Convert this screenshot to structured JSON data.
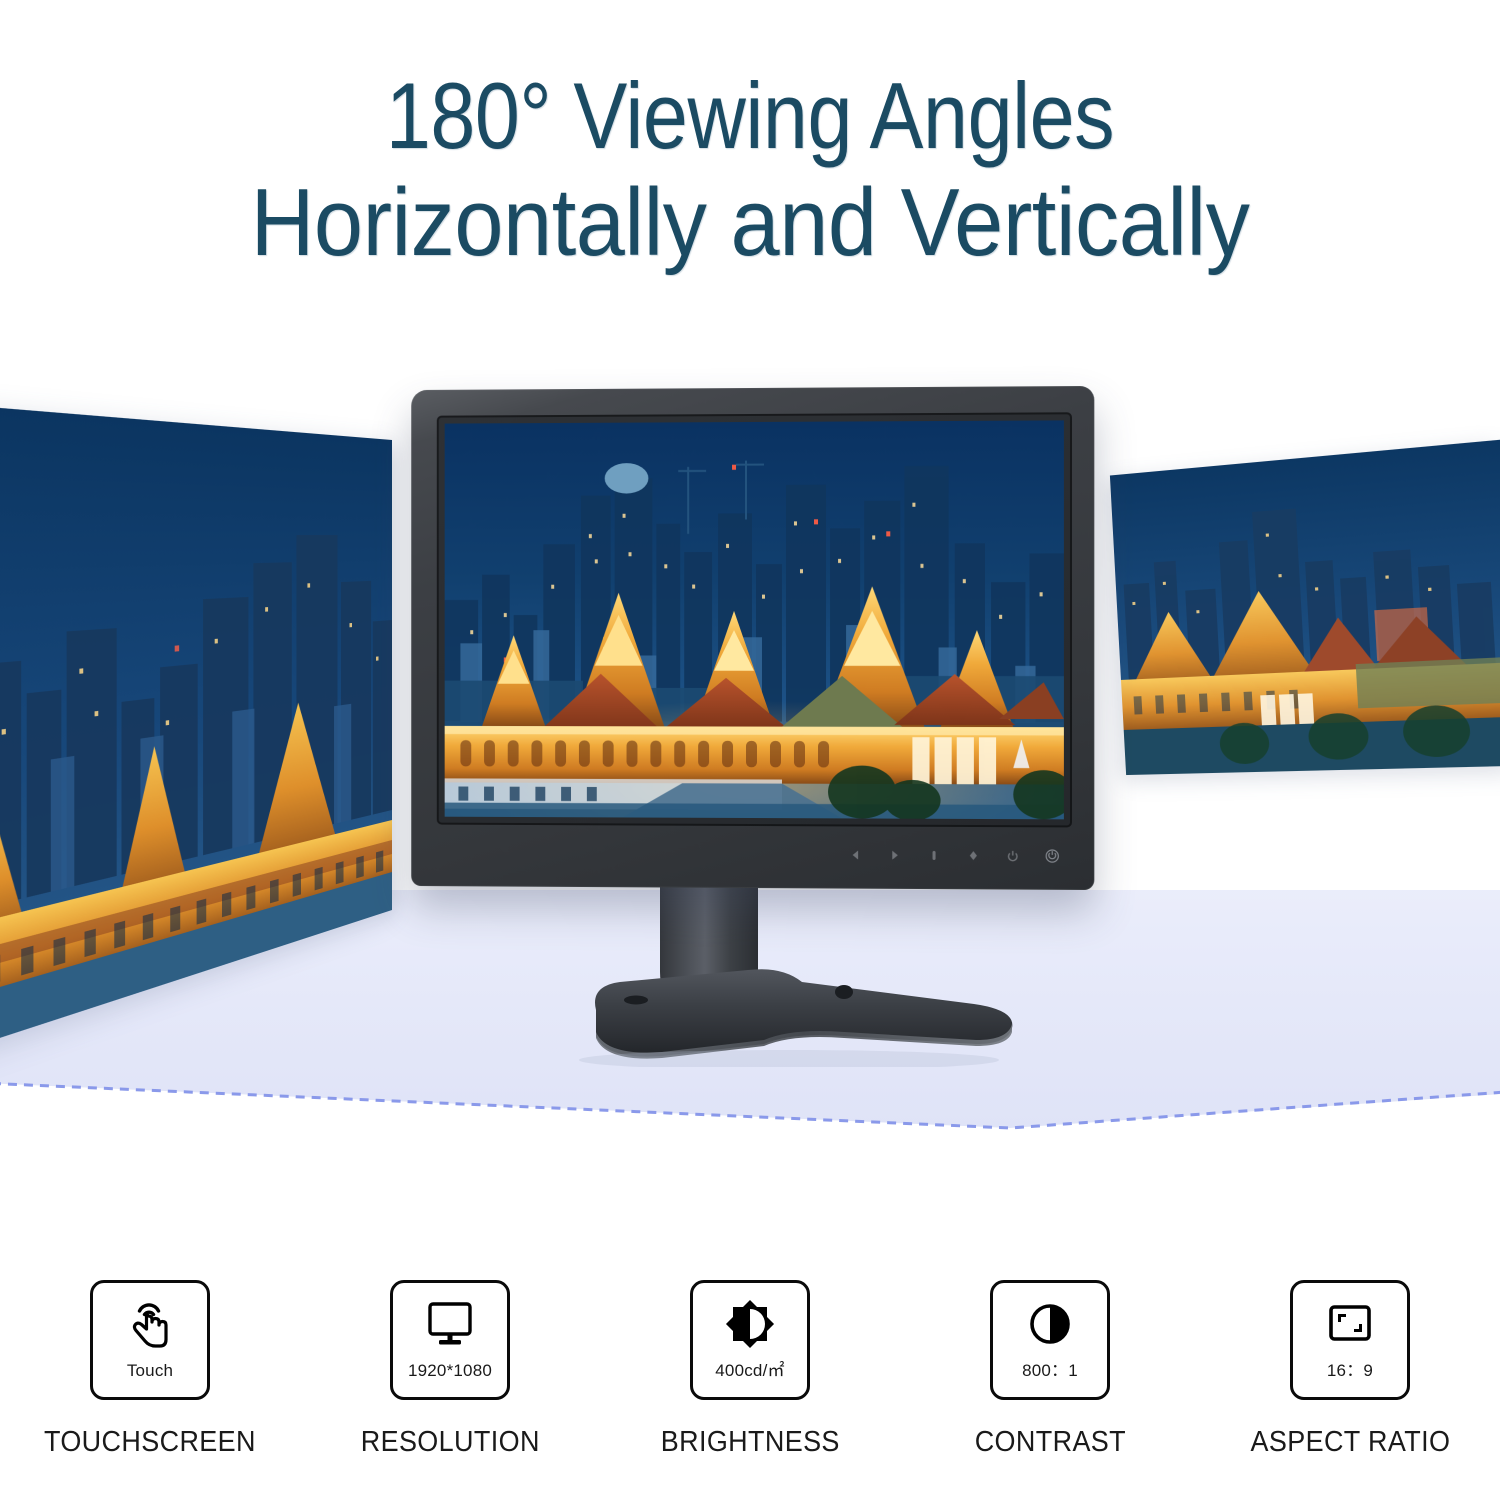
{
  "headline": {
    "line1": "180° Viewing Angles",
    "line2": "Horizontally and Vertically"
  },
  "colors": {
    "headline": "#1b4b63",
    "floor_dash": "#8a99ea",
    "floor_fill": "#eceefb",
    "bezel": "#34373b",
    "screen_sky": "#0d3763",
    "screen_gold": "#e8a13a"
  },
  "product": {
    "type": "touchscreen-monitor",
    "screen_content": "Bangkok Grand Palace illuminated at night with city skyline at dusk",
    "controls": [
      {
        "name": "left-arrow-button",
        "glyph": "left"
      },
      {
        "name": "right-arrow-button",
        "glyph": "right"
      },
      {
        "name": "menu-button",
        "glyph": "menu"
      },
      {
        "name": "source-button",
        "glyph": "diamond"
      },
      {
        "name": "power-button",
        "glyph": "power"
      },
      {
        "name": "power-indicator",
        "glyph": "indicator"
      }
    ]
  },
  "angle_panels": [
    {
      "name": "left-viewing-angle-panel",
      "position": "left"
    },
    {
      "name": "right-viewing-angle-panel",
      "position": "right"
    }
  ],
  "features": [
    {
      "icon": "touch-hand-icon",
      "value": "Touch",
      "label": "TOUCHSCREEN"
    },
    {
      "icon": "monitor-icon",
      "value": "1920*1080",
      "label": "RESOLUTION"
    },
    {
      "icon": "brightness-icon",
      "value": "400cd/㎡",
      "label": "BRIGHTNESS"
    },
    {
      "icon": "contrast-icon",
      "value": "800：1",
      "label": "CONTRAST"
    },
    {
      "icon": "aspect-ratio-icon",
      "value": "16：9",
      "label": "ASPECT RATIO"
    }
  ]
}
